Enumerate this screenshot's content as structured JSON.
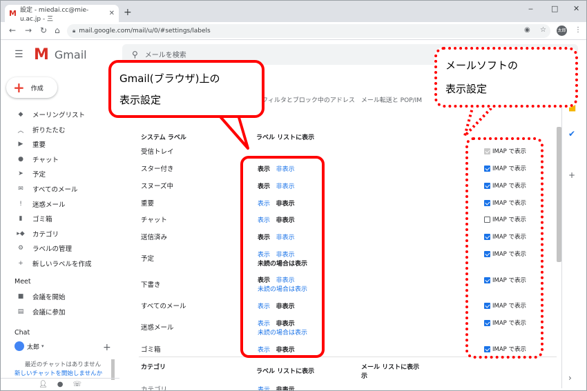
{
  "browser": {
    "tab_title": "設定 - miedai.cc@mie-u.ac.jp - 三",
    "tab_favicon": "M",
    "new_tab": "+",
    "minimize": "‒",
    "maximize": "□",
    "close": "✕",
    "url": "mail.google.com/mail/u/0/#settings/labels",
    "profile_initials": "太郎"
  },
  "gmail": {
    "logo_text": "Gmail",
    "search_placeholder": "メールを検索",
    "compose_label": "作成"
  },
  "sidebar": {
    "items": [
      {
        "icon": "label-icon",
        "label": "メーリングリスト"
      },
      {
        "icon": "collapse-icon",
        "label": "折りたたむ"
      },
      {
        "icon": "important-icon",
        "label": "重要"
      },
      {
        "icon": "chat-icon",
        "label": "チャット"
      },
      {
        "icon": "scheduled-icon",
        "label": "予定"
      },
      {
        "icon": "all-mail-icon",
        "label": "すべてのメール"
      },
      {
        "icon": "spam-icon",
        "label": "迷惑メール"
      },
      {
        "icon": "trash-icon",
        "label": "ゴミ箱"
      },
      {
        "icon": "category-icon",
        "label": "カテゴリ"
      },
      {
        "icon": "gear-icon",
        "label": "ラベルの管理"
      },
      {
        "icon": "plus-icon",
        "label": "新しいラベルを作成"
      }
    ],
    "meet_heading": "Meet",
    "meet_items": [
      {
        "icon": "video-icon",
        "label": "会議を開始"
      },
      {
        "icon": "keyboard-icon",
        "label": "会議に参加"
      }
    ],
    "chat_heading": "Chat",
    "chat_user": "太郎",
    "no_chats": "最近のチャットはありません",
    "start_chat": "新しいチャットを開始しませんか"
  },
  "settings": {
    "tabs_text": "フィルタとブロック中のアドレス　メール転送と POP/IM",
    "section_system": "システム ラベル",
    "col_label_list": "ラベル リストに表示",
    "show": "表示",
    "hide": "非表示",
    "unread_only": "未読の場合は表示",
    "imap_label": "IMAP で表示",
    "rows": [
      {
        "name": "受信トレイ",
        "imap": "disabled"
      },
      {
        "name": "スター付き",
        "imap": "on"
      },
      {
        "name": "スヌーズ中",
        "imap": "on"
      },
      {
        "name": "重要",
        "imap": "on"
      },
      {
        "name": "チャット",
        "imap": "off"
      },
      {
        "name": "送信済み",
        "imap": "on"
      },
      {
        "name": "予定",
        "imap": "on"
      },
      {
        "name": "下書き",
        "imap": "on"
      },
      {
        "name": "すべてのメール",
        "imap": "on"
      },
      {
        "name": "迷惑メール",
        "imap": "on"
      },
      {
        "name": "ゴミ箱",
        "imap": "on"
      }
    ],
    "section_category": "カテゴリ",
    "col_mail_list": "メール リストに表示",
    "col_mail_list_2": "示",
    "category_row": "カテゴリ"
  },
  "callouts": {
    "left": [
      "Gmail(ブラウザ)上の",
      "表示設定"
    ],
    "right": [
      "メールソフトの",
      "表示設定"
    ]
  },
  "colors": {
    "accent": "#1a73e8",
    "callout": "#ff0000"
  }
}
